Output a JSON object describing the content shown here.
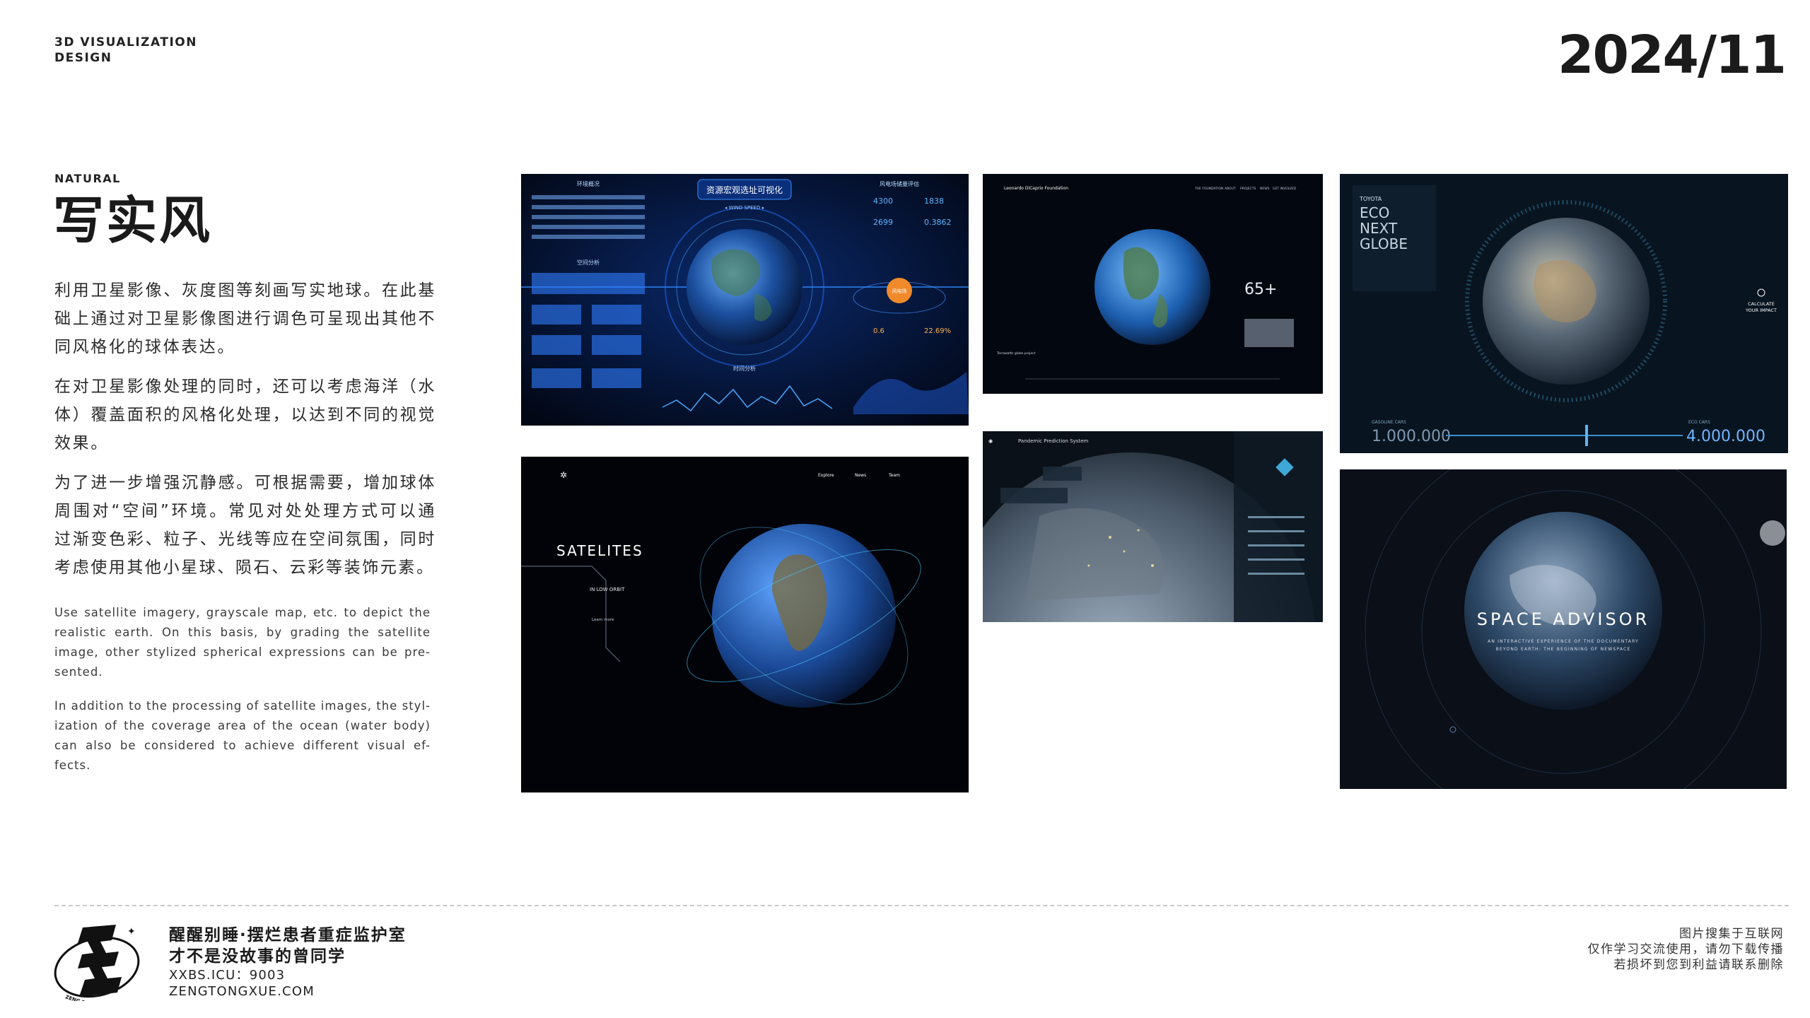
{
  "header": {
    "brand_line1": "3D VISUALIZATION",
    "brand_line2": "DESIGN",
    "date": "2024/11"
  },
  "intro": {
    "label": "NATURAL",
    "title": "写实风",
    "cn_paragraphs": [
      "利用卫星影像、灰度图等刻画写实地球。在此基础上通过对卫星影像图进行调色可呈现出其他不同风格化的球体表达。",
      "在对卫星影像处理的同时，还可以考虑海洋（水体）覆盖面积的风格化处理，以达到不同的视觉效果。",
      "为了进一步增强沉静感。可根据需要，增加球体周围对“空间”环境。常见对处处理方式可以通过渐变色彩、粒子、光线等应在空间氛围，同时考虑使用其他小星球、陨石、云彩等装饰元素。"
    ],
    "en_paragraphs": [
      "Use satellite imagery, grayscale map, etc. to depict the realistic earth. On this basis, by grading the satellite image, other stylized spherical expressions can be pre-sented.",
      "In addition to the processing of satellite images, the styl-ization of the coverage area of the ocean (water body) can also be considered to achieve different visual ef-fects."
    ]
  },
  "gallery": {
    "shot1": {
      "title": "资源宏观选址可视化",
      "wind": "◂ WIND SPEED ▸",
      "left_panel": "环境概况",
      "right_panel": "风电场储量评估",
      "mid_left": "空间分析",
      "bottom": "时间分析",
      "stat1": "4300",
      "stat2": "1838",
      "stat3": "2699",
      "stat4": "0.3862",
      "stat5": "0.6",
      "stat6": "22.69%",
      "center_badge": "风电场"
    },
    "shot2": {
      "brand": "Leonardo DiCaprio Foundation",
      "stat": "65+",
      "nav": [
        "THE FOUNDATION",
        "ABOUT",
        "PROJECTS",
        "NEWS",
        "GET INVOLVED"
      ],
      "caption": "Terrawatts globe project"
    },
    "shot3": {
      "brand": "TOYOTA",
      "title_lines": [
        "ECO",
        "NEXT",
        "GLOBE"
      ],
      "cta_line1": "CALCULATE",
      "cta_line2": "YOUR IMPACT",
      "left_label": "GASOLINE CARS",
      "left_value": "1.000.000",
      "right_label": "ECO CARS",
      "right_value": "4.000.000"
    },
    "shot4": {
      "title": "SATELITES",
      "subtitle": "IN LOW ORBIT",
      "link": "Learn more",
      "nav": [
        "Explore",
        "News",
        "Team"
      ]
    },
    "shot5": {
      "title": "Pandemic Prediction System"
    },
    "shot6": {
      "title": "SPACE ADVISOR",
      "subtitle1": "AN INTERACTIVE EXPERIENCE OF THE DOCUMENTARY",
      "subtitle2": "BEYOND EARTH: THE BEGINNING OF NEWSPACE"
    }
  },
  "footer": {
    "line1": "醒醒别睡·摆烂患者重症监护室",
    "line2": "才不是没故事的曾同学",
    "line3": "XXBS.ICU：9003",
    "line4": "ZENGTONGXUE.COM",
    "logo_text": "ZENG TONG XUE",
    "right_line1": "图片搜集于互联网",
    "right_line2": "仅作学习交流使用，请勿下载传播",
    "right_line3": "若损坏到您到利益请联系删除"
  },
  "colors": {
    "accent_blue": "#1e6cff",
    "dark_bg": "#050a18",
    "text": "#1a1a1a"
  }
}
